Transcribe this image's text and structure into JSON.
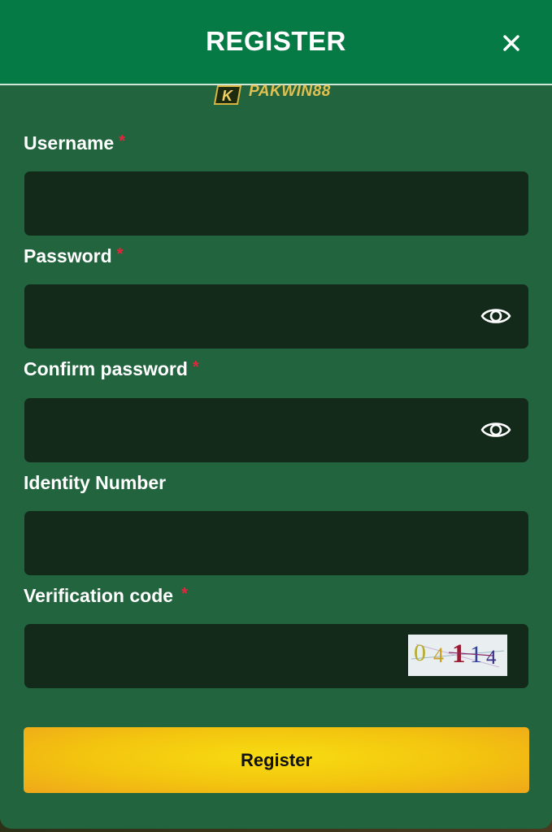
{
  "dialog": {
    "title": "REGISTER",
    "close_icon": "close-icon",
    "logo_text": "PAKWIN88"
  },
  "form": {
    "username": {
      "label": "Username",
      "required": "*",
      "value": "",
      "placeholder": ""
    },
    "password": {
      "label": "Password",
      "required": "*",
      "value": "",
      "placeholder": "",
      "toggle_icon": "eye-icon"
    },
    "confirm_password": {
      "label": "Confirm password",
      "required": "*",
      "value": "",
      "placeholder": "",
      "toggle_icon": "eye-icon"
    },
    "identity_number": {
      "label": "Identity Number",
      "value": "",
      "placeholder": ""
    },
    "verification_code": {
      "label": "Verification code",
      "required": "*",
      "value": "",
      "placeholder": "",
      "captcha_digits": [
        "0",
        "4",
        "1",
        "1",
        "4"
      ]
    }
  },
  "actions": {
    "register_label": "Register"
  },
  "colors": {
    "header_bg": "#067a45",
    "body_bg": "#22643e",
    "field_bg": "#13291a",
    "required": "#e8243c",
    "button_yellow": "#f3c40f",
    "button_orange": "#efa71a"
  }
}
